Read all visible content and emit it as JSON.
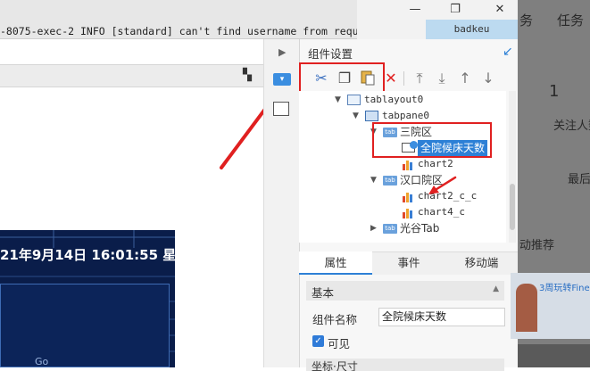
{
  "log": {
    "text": "-8075-exec-2 INFO [standard] can't find username from request: JWT s...",
    "username": "badkeu"
  },
  "window_controls": {
    "minimize": "—",
    "restore": "❐",
    "close": "✕"
  },
  "canvas": {
    "timestamp": "21年9月14日 16:01:55 星",
    "dashboard_label": "Go"
  },
  "panel": {
    "title": "组件设置",
    "tree": {
      "n1": "tablayout0",
      "n2": "tabpane0",
      "n3": "三院区",
      "n4": "全院候床天数",
      "n5": "chart2",
      "n6": "汉口院区",
      "n7": "chart2_c_c",
      "n8": "chart4_c",
      "n9": "光谷Tab",
      "tab_icon_text": "tab"
    },
    "tabs": [
      "属性",
      "事件",
      "移动端"
    ],
    "section_basic": "基本",
    "name_label": "组件名称",
    "name_value": "全院候床天数",
    "visible_label": "可见",
    "section_position": "坐标·尺寸"
  },
  "web": {
    "nav_1": "务",
    "nav_2": "任务",
    "stat_value": "1",
    "stat_label": "关注人数",
    "row_label": "最后",
    "recommend": "动推荐",
    "ad_text": "3周玩转Fine"
  },
  "colors": {
    "accent_blue": "#2d80d6",
    "annotation_red": "#e02020",
    "dashboard_bg": "#0a1d4a"
  }
}
